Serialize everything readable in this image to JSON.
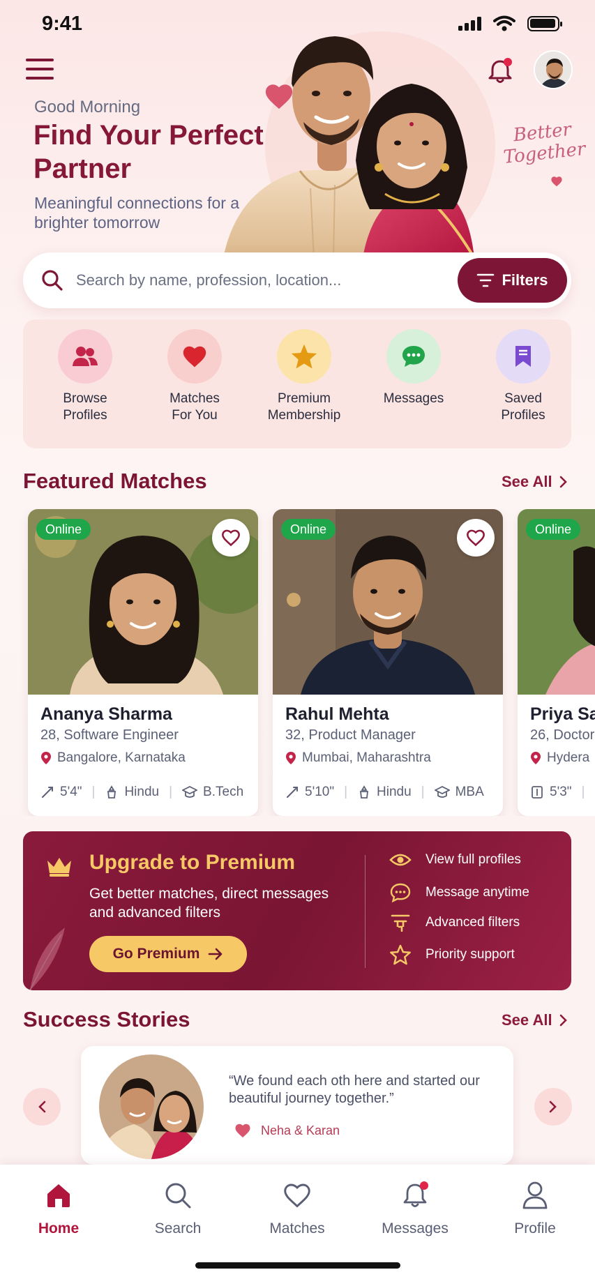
{
  "status_bar": {
    "time": "9:41"
  },
  "hero": {
    "greeting": "Good Morning",
    "headline": "Find Your Perfect Partner",
    "subline": "Meaningful connections for a brighter tomorrow",
    "tagline_line1": "Better",
    "tagline_line2": "Together"
  },
  "search": {
    "placeholder": "Search by name, profession, location...",
    "filters_label": "Filters"
  },
  "quick_actions": [
    {
      "label_line1": "Browse",
      "label_line2": "Profiles",
      "icon": "users-icon",
      "bg": "#f8ccd2",
      "color": "#c2244a"
    },
    {
      "label_line1": "Matches",
      "label_line2": "For You",
      "icon": "heart-icon",
      "bg": "#f9cfcd",
      "color": "#d9252e"
    },
    {
      "label_line1": "Premium",
      "label_line2": "Membership",
      "icon": "star-icon",
      "bg": "#fbe3a9",
      "color": "#e59a13"
    },
    {
      "label_line1": "Messages",
      "label_line2": "",
      "icon": "chat-icon",
      "bg": "#d7f0d9",
      "color": "#22a44a"
    },
    {
      "label_line1": "Saved",
      "label_line2": "Profiles",
      "icon": "bookmark-icon",
      "bg": "#e4dbf7",
      "color": "#7a4bd0"
    }
  ],
  "featured": {
    "title": "Featured Matches",
    "see_all": "See All",
    "profiles": [
      {
        "online": "Online",
        "name": "Ananya Sharma",
        "info": "28, Software Engineer",
        "location": "Bangalore, Karnataka",
        "height": "5'4\"",
        "religion": "Hindu",
        "education": "B.Tech"
      },
      {
        "online": "Online",
        "name": "Rahul Mehta",
        "info": "32, Product Manager",
        "location": "Mumbai, Maharashtra",
        "height": "5'10\"",
        "religion": "Hindu",
        "education": "MBA"
      },
      {
        "online": "Online",
        "name": "Priya Sa",
        "info": "26, Doctor",
        "location": "Hydera",
        "height": "5'3\""
      }
    ]
  },
  "premium": {
    "title": "Upgrade to Premium",
    "description": "Get better matches, direct messages and advanced filters",
    "button": "Go Premium",
    "features": [
      "View full profiles",
      "Message anytime",
      "Advanced filters",
      "Priority support"
    ],
    "accent": "#f7c866"
  },
  "success": {
    "title": "Success Stories",
    "see_all": "See All",
    "quote": "“We found each oth   here and started our beautiful journey together.”",
    "names": "Neha & Karan"
  },
  "bottom_nav": [
    {
      "label": "Home",
      "icon": "home-icon",
      "active": true
    },
    {
      "label": "Search",
      "icon": "search-icon",
      "active": false
    },
    {
      "label": "Matches",
      "icon": "heart-outline-icon",
      "active": false
    },
    {
      "label": "Messages",
      "icon": "bell-chat-icon",
      "active": false
    },
    {
      "label": "Profile",
      "icon": "person-icon",
      "active": false
    }
  ],
  "colors": {
    "brand": "#7d1536",
    "online": "#1fa64a",
    "accent_gold": "#f7c866"
  }
}
